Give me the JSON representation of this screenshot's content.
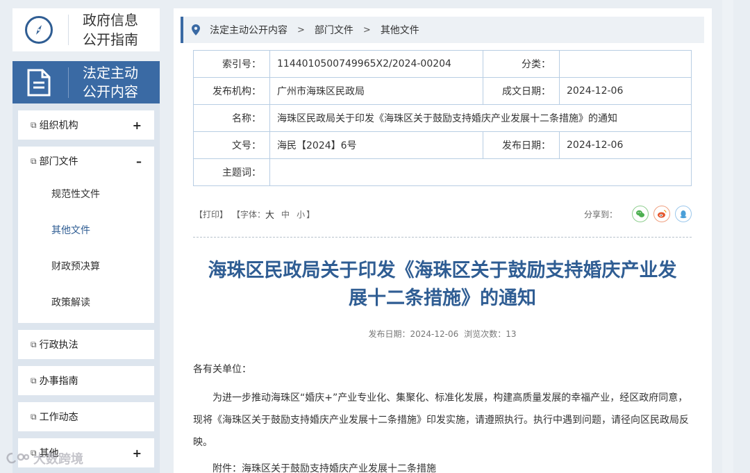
{
  "sidebar": {
    "guide_title": "政府信息公开指南",
    "guide_line1": "政府信息",
    "guide_line2": "公开指南",
    "active_line1": "法定主动",
    "active_line2": "公开内容",
    "groups": [
      {
        "label": "组织机构",
        "toggle": "+"
      },
      {
        "label": "部门文件",
        "toggle": "–",
        "children": [
          "规范性文件",
          "其他文件",
          "财政预决算",
          "政策解读"
        ]
      },
      {
        "label": "行政执法"
      },
      {
        "label": "办事指南"
      },
      {
        "label": "工作动态"
      },
      {
        "label": "其他",
        "toggle": "+"
      }
    ],
    "accent_color": "#3a6aa4"
  },
  "breadcrumb": [
    "法定主动公开内容",
    "部门文件",
    "其他文件"
  ],
  "meta": {
    "index_label": "索引号：",
    "index_value": "1144010500749965X2/2024-00204",
    "category_label": "分类：",
    "category_value": "",
    "publisher_label": "发布机构：",
    "publisher_value": "广州市海珠区民政局",
    "created_label": "成文日期：",
    "created_value": "2024-12-06",
    "name_label": "名称：",
    "name_value": "海珠区民政局关于印发《海珠区关于鼓励支持婚庆产业发展十二条措施》的通知",
    "docno_label": "文号：",
    "docno_value": "海民【2024】6号",
    "publish_label": "发布日期：",
    "publish_value": "2024-12-06",
    "keyword_label": "主题词："
  },
  "tools": {
    "print": "【打印】",
    "font_prefix": "【字体：",
    "font_big": "大",
    "font_mid": "中",
    "font_small": "小",
    "font_suffix": "】",
    "share_label": "分享到："
  },
  "article": {
    "title_line1": "海珠区民政局关于印发《海珠区关于鼓励支持婚庆产业发",
    "title_line2": "展十二条措施》的通知",
    "publish_date_label": "发布日期：2024-12-06",
    "views_label": "浏览次数：13",
    "greeting": "各有关单位：",
    "paragraph": "为进一步推动海珠区“婚庆+”产业专业化、集聚化、标准化发展，构建高质量发展的幸福产业，经区政府同意，现将《海珠区关于鼓励支持婚庆产业发展十二条措施》印发实施，请遵照执行。执行中遇到问题，请径向区民政局反映。",
    "attachment": "附件：海珠区关于鼓励支持婚庆产业发展十二条措施"
  },
  "watermark": "大数跨境",
  "colors": {
    "title": "#2f5d93",
    "wechat": "#4caf50",
    "weibo": "#e4572e",
    "qq": "#4a9fd8"
  }
}
